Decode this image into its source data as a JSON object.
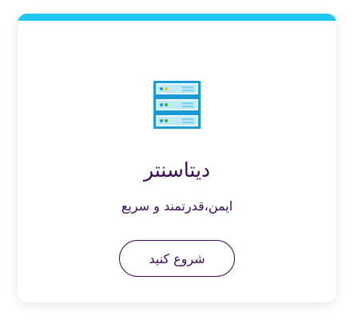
{
  "card": {
    "accent_color": "#1fc8f2",
    "text_color": "#3d0a55",
    "icon": "server-rack-icon",
    "title": "دیتاسنتر",
    "subtitle": "ایمن،قدرتمند و سریع",
    "button_label": "شروع کنید"
  }
}
